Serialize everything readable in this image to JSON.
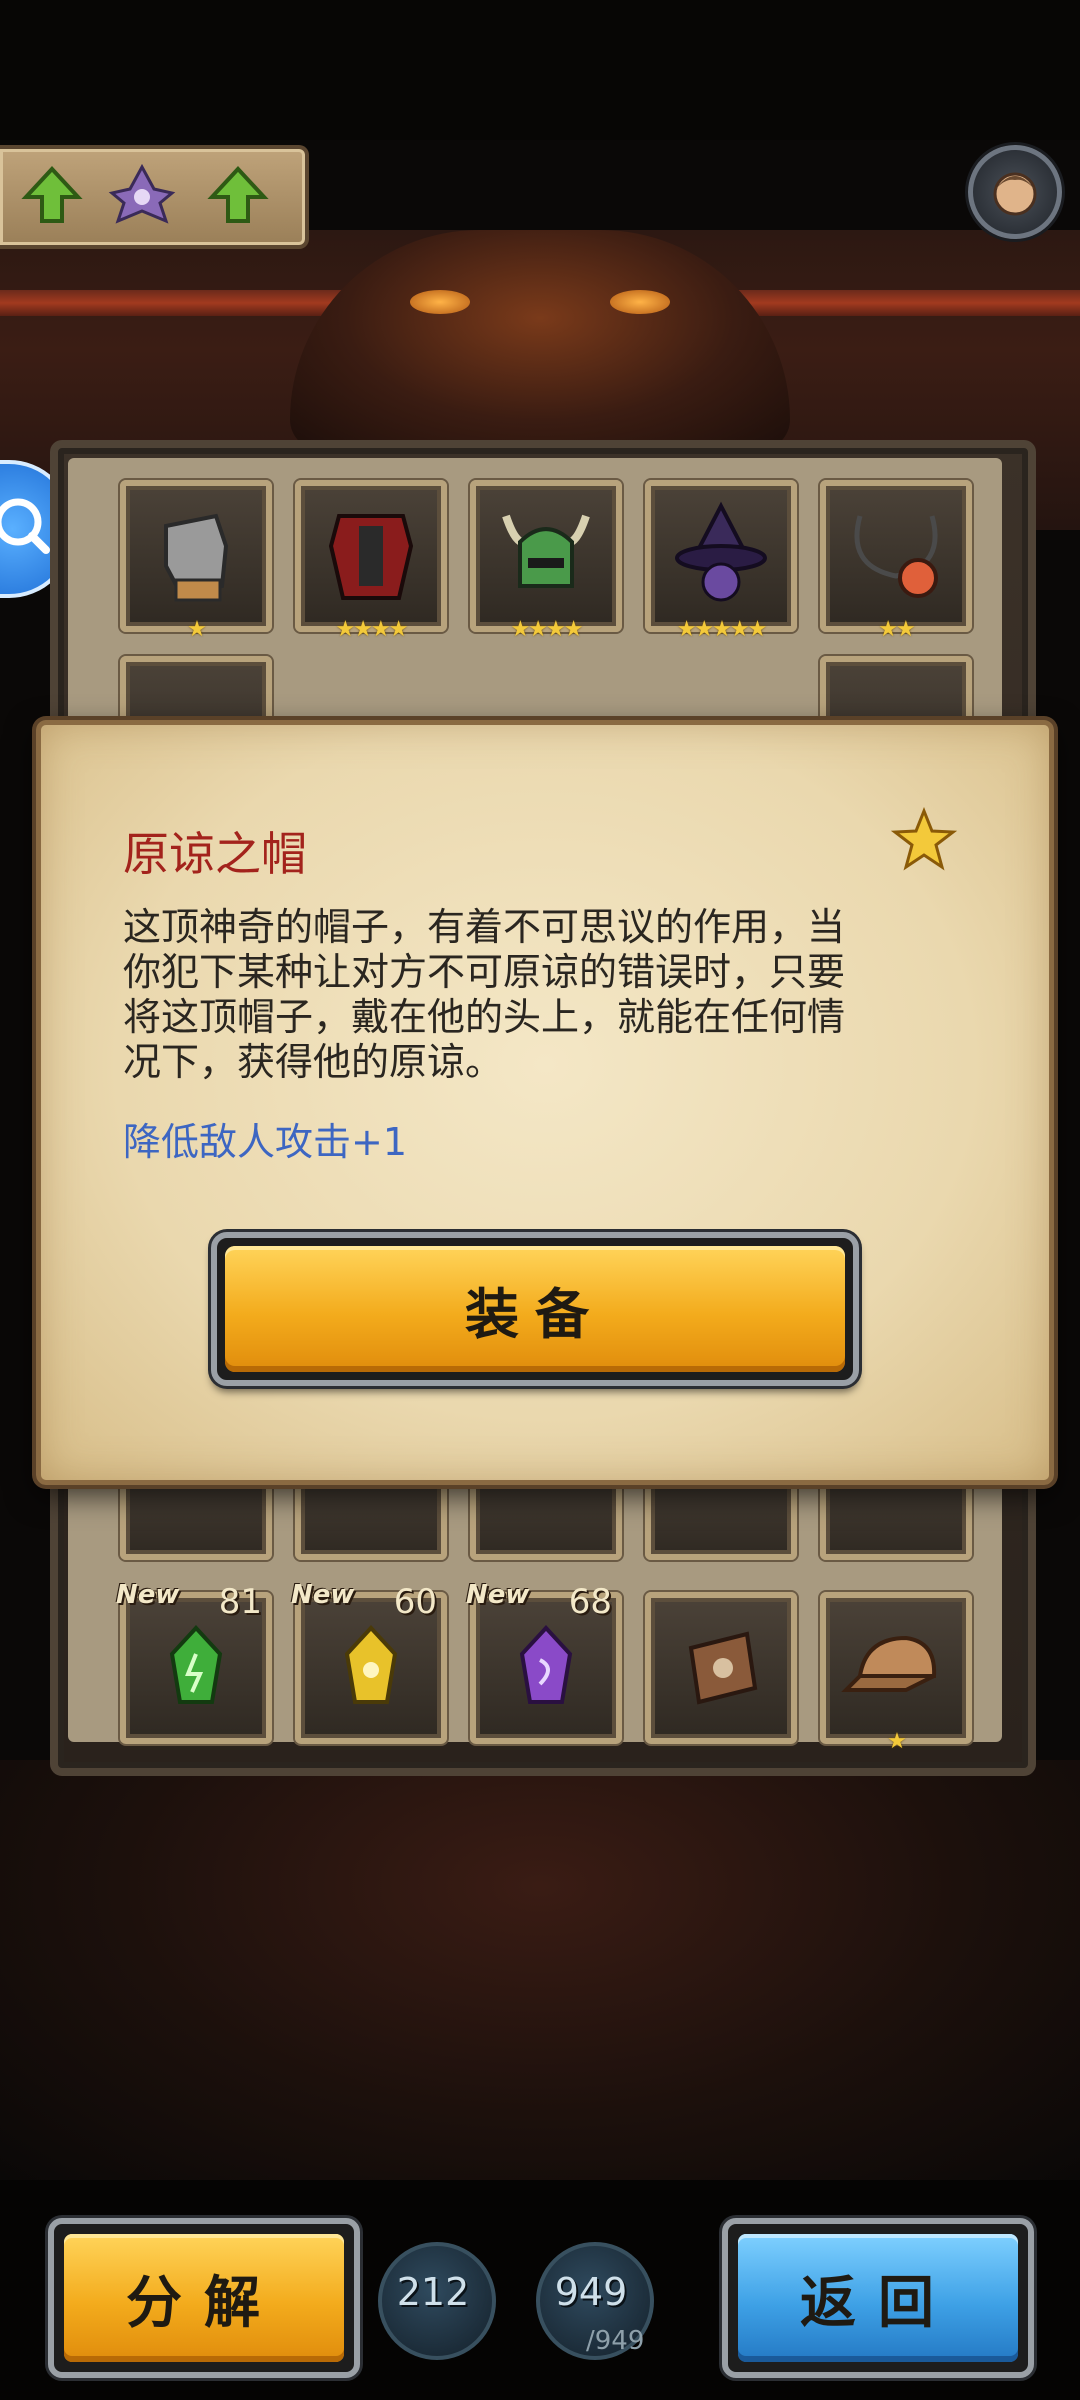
{
  "top_bar": {
    "left_panel_icons": [
      "arrow-up-icon",
      "wizard-ghost-icon",
      "arrow-up-icon"
    ],
    "avatar_icon": "hero-avatar-icon"
  },
  "side_search_icon": "search-icon",
  "inventory": {
    "row1": [
      {
        "item_icon": "gauntlet-icon",
        "stars": "★"
      },
      {
        "item_icon": "armor-icon",
        "stars": "★★★★"
      },
      {
        "item_icon": "horned-helmet-icon",
        "stars": "★★★★"
      },
      {
        "item_icon": "witch-hat-icon",
        "stars": "★★★★★"
      },
      {
        "item_icon": "amulet-icon",
        "stars": "★★"
      }
    ],
    "row_bottom": [
      {
        "item_icon": "green-crystal-icon",
        "badge": "New",
        "count": "81"
      },
      {
        "item_icon": "yellow-crystal-icon",
        "badge": "New",
        "count": "60"
      },
      {
        "item_icon": "purple-crystal-icon",
        "badge": "New",
        "count": "68"
      },
      {
        "item_icon": "book-icon"
      },
      {
        "item_icon": "cap-icon",
        "stars": "★"
      }
    ]
  },
  "dialog": {
    "title": "原谅之帽",
    "rarity_icon": "star-icon",
    "description_line1": "这顶神奇的帽子，有着不可思议的作用，当",
    "description_line2": "你犯下某种让对方不可原谅的错误时，只要",
    "description_line3": "将这顶帽子，戴在他的头上，就能在任何情",
    "description_line4": "况下，获得他的原谅。",
    "effect": "降低敌人攻击+1",
    "equip_label": "装备"
  },
  "bottom_bar": {
    "decompose_label": "分解",
    "resource1_value": "212",
    "resource2_value": "949",
    "resource2_max": "/949",
    "back_label": "返回"
  },
  "colors": {
    "title_red": "#a3231c",
    "effect_blue": "#3d66c2",
    "button_gold": "#f3ab1c",
    "button_blue": "#3ea1e6",
    "star_gold": "#f3c93a"
  }
}
